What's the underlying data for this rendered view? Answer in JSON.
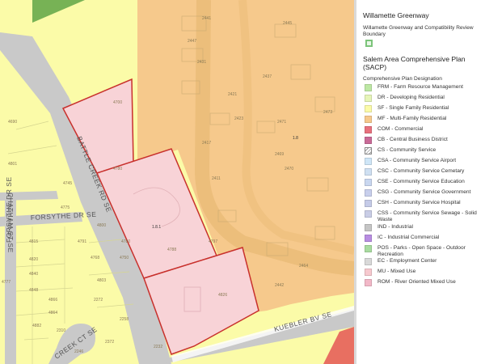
{
  "map": {
    "roads": {
      "battle_creek": "BATTLE CREEK RD SE",
      "forsythe": "FORSYTHE DR SE",
      "forsythe_vertical": "FORSYTHE DR SE",
      "chatham": "CHATHAM ST SE",
      "kuebler": "KUEBLER BV SE",
      "creek_ct": "CREEK CT SE"
    },
    "zone_labels": {
      "mu": "1.8.1",
      "mf": "1.8"
    },
    "addresses": [
      "4700",
      "4780",
      "4788",
      "4826",
      "4797",
      "2411",
      "2417",
      "2421",
      "2431",
      "2441",
      "2447",
      "2423",
      "2471",
      "2469",
      "2445",
      "2470",
      "2473",
      "2437",
      "2442",
      "2464",
      "4690",
      "4775",
      "4745",
      "4791",
      "4768",
      "4815",
      "4820",
      "4840",
      "4848",
      "4866",
      "4864",
      "4882",
      "4803",
      "2310",
      "2372",
      "2246",
      "2258",
      "2272",
      "2232",
      "4750",
      "4780",
      "4800",
      "4801",
      "4777"
    ],
    "colors": {
      "sf": "#fbfba8",
      "mf": "#f6c98c",
      "mu": "#f8d3d7",
      "mu_border": "#c8302c",
      "greenway": "#77b255",
      "road": "#c7c7c7",
      "com": "#e86f61"
    }
  },
  "legend": {
    "greenway_title": "Willamette Greenway",
    "greenway_desc": "Willamette Greenway and Compatibility Review Boundary",
    "greenway_icon": "greenway-boundary-icon",
    "sacp_title": "Salem Area Comprehensive Plan (SACP)",
    "designation_subtitle": "Comprehensive Plan Designation",
    "items": [
      {
        "label": "FRM - Farm Resource Management",
        "color": "#bde8a4"
      },
      {
        "label": "DR - Developing Residential",
        "color": "#e6f5b8"
      },
      {
        "label": "SF - Single Family Residential",
        "color": "#fbfba8"
      },
      {
        "label": "MF - Multi-Family Residential",
        "color": "#f6c98c"
      },
      {
        "label": "COM - Commercial",
        "color": "#e8707d"
      },
      {
        "label": "CB - Central Business District",
        "color": "#c96a97"
      },
      {
        "label": "CS - Community Service",
        "color": "hatch"
      },
      {
        "label": "CSA - Community Service Airport",
        "color": "#cfe6f7"
      },
      {
        "label": "CSC - Community Service Cemetary",
        "color": "#cfe0f2"
      },
      {
        "label": "CSE - Community Service Education",
        "color": "#c9d7f0"
      },
      {
        "label": "CSG - Community Service Government",
        "color": "#c8cfec"
      },
      {
        "label": "CSH - Community Service Hospital",
        "color": "#c5cbe8"
      },
      {
        "label": "CSS - Community Service Sewage - Solid Waste",
        "color": "#c9cde6"
      },
      {
        "label": "IND - Industrial",
        "color": "#c5c5c5"
      },
      {
        "label": "IC - Industrial Commercial",
        "color": "#b88de2"
      },
      {
        "label": "POS - Parks - Open Space - Outdoor Recreation",
        "color": "#a9dca0"
      },
      {
        "label": "EC - Employment Center",
        "color": "#d9d9d9"
      },
      {
        "label": "MU - Mixed Use",
        "color": "#f7c9cf"
      },
      {
        "label": "ROM - River Oriented Mixed Use",
        "color": "#f2b8c8"
      }
    ]
  }
}
